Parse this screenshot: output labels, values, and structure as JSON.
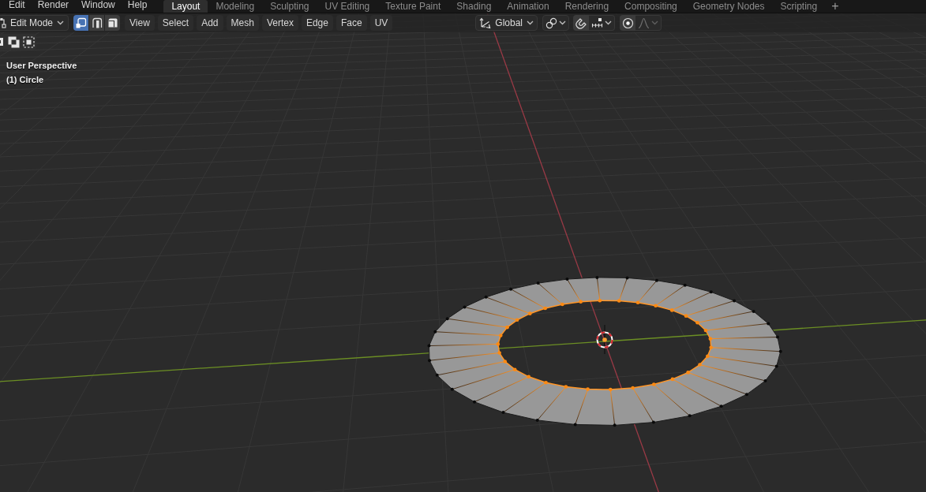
{
  "topbar": {
    "menus": [
      "Edit",
      "Render",
      "Window",
      "Help"
    ],
    "workspaces": [
      {
        "label": "Layout",
        "selected": true
      },
      {
        "label": "Modeling",
        "selected": false
      },
      {
        "label": "Sculpting",
        "selected": false
      },
      {
        "label": "UV Editing",
        "selected": false
      },
      {
        "label": "Texture Paint",
        "selected": false
      },
      {
        "label": "Shading",
        "selected": false
      },
      {
        "label": "Animation",
        "selected": false
      },
      {
        "label": "Rendering",
        "selected": false
      },
      {
        "label": "Compositing",
        "selected": false
      },
      {
        "label": "Geometry Nodes",
        "selected": false
      },
      {
        "label": "Scripting",
        "selected": false
      }
    ],
    "add_tab": "+"
  },
  "header": {
    "mode": "Edit Mode",
    "select_modes": [
      {
        "kind": "vertex",
        "selected": true
      },
      {
        "kind": "edge",
        "selected": false
      },
      {
        "kind": "face",
        "selected": false
      }
    ],
    "menus": [
      "View",
      "Select",
      "Add",
      "Mesh",
      "Vertex",
      "Edge",
      "Face",
      "UV"
    ],
    "orientation": "Global",
    "snap": {
      "on": false
    },
    "proportional": {
      "on": false
    }
  },
  "viewport": {
    "view_name": "User Perspective",
    "object_label": "(1) Circle"
  }
}
